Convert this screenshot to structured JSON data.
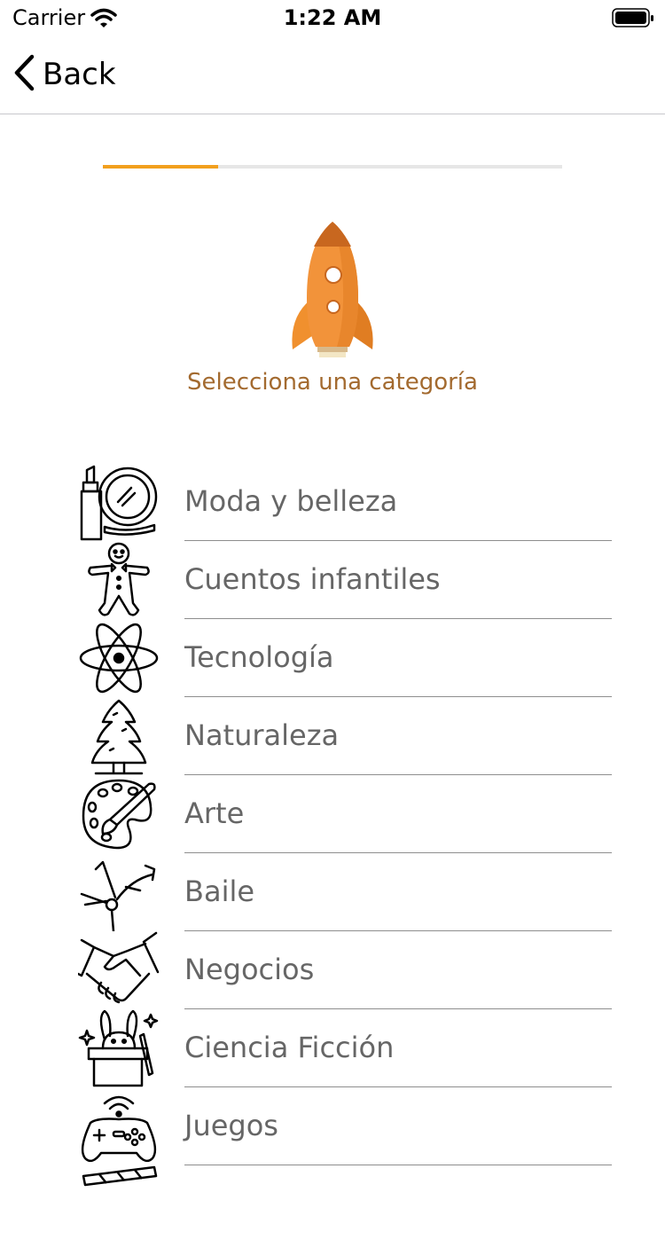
{
  "status_bar": {
    "carrier": "Carrier",
    "time": "1:22 AM"
  },
  "nav": {
    "back_label": "Back"
  },
  "progress": {
    "value": 0.25,
    "color": "#F2A01E"
  },
  "header": {
    "title": "Selecciona una categoría",
    "title_color": "#A36A2F",
    "icon": "rocket-icon"
  },
  "categories": [
    {
      "label": "Moda y belleza",
      "icon": "lipstick-mirror-icon"
    },
    {
      "label": "Cuentos infantiles",
      "icon": "gingerbread-man-icon"
    },
    {
      "label": "Tecnología",
      "icon": "atom-icon"
    },
    {
      "label": "Naturaleza",
      "icon": "pine-tree-icon"
    },
    {
      "label": "Arte",
      "icon": "paint-palette-icon"
    },
    {
      "label": "Baile",
      "icon": "breakdancer-icon"
    },
    {
      "label": "Negocios",
      "icon": "handshake-icon"
    },
    {
      "label": "Ciencia Ficción",
      "icon": "magic-hat-rabbit-icon"
    },
    {
      "label": "Juegos",
      "icon": "gamepad-icon"
    }
  ]
}
